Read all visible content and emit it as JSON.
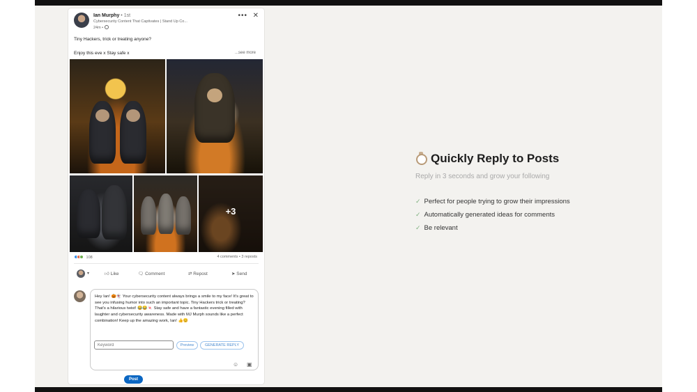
{
  "post": {
    "author": "Ian Murphy",
    "degree": "• 1st",
    "headline": "Cybersecurity Content That Captivates | Stand Up Co...",
    "time": "24m •",
    "line1": "Tiny Hackers, trick or treating anyone?",
    "line2": "Enjoy this eve x Stay safe x",
    "see_more": "...see more",
    "more_images": "+3",
    "reactions_count": "108",
    "stats": "4 comments • 3 reposts"
  },
  "actions": {
    "like": "Like",
    "comment": "Comment",
    "repost": "Repost",
    "send": "Send"
  },
  "comment": {
    "text": "Hey Ian! 🎃👻 Your cybersecurity content always brings a smile to my face! It's great to see you infusing humor into such an important topic. Tiny Hackers trick or treating? That's a hilarious twist! 😂😂🍬 Stay safe and have a fantastic evening filled with laughter and cybersecurity awareness. Made with MJ Murph sounds like a perfect combination! Keep up the amazing work, Ian! 👍😊",
    "keyword_placeholder": "Keyword",
    "preview_label": "Preview",
    "generate_label": "GENERATE REPLY",
    "post_label": "Post"
  },
  "feature": {
    "title": "Quickly Reply to Posts",
    "subtitle": "Reply in 3 seconds and grow your following",
    "items": [
      "Perfect for people trying to grow their impressions",
      "Automatically generated ideas for comments",
      "Be relevant"
    ]
  },
  "colors": {
    "accent": "#0a66c2",
    "check": "#7fb07f",
    "background": "#f3f2ef"
  }
}
